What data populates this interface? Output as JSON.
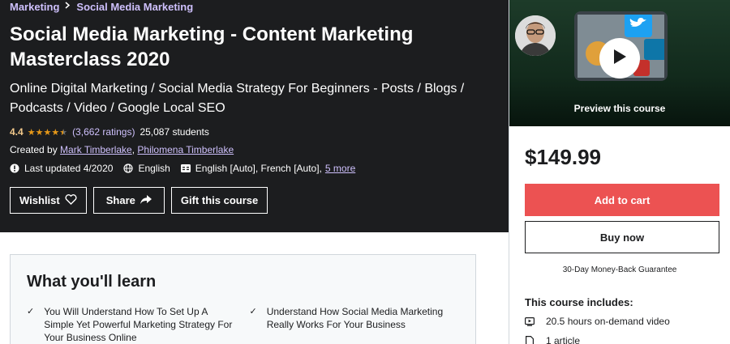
{
  "breadcrumb": {
    "items": [
      "Marketing",
      "Social Media Marketing"
    ],
    "separator": ">"
  },
  "course": {
    "title": "Social Media Marketing - Content Marketing Masterclass 2020",
    "subtitle": "Online Digital Marketing / Social Media Strategy For Beginners - Posts / Blogs / Podcasts / Video / Google Local SEO",
    "rating": "4.4",
    "rating_value": 4.4,
    "ratings_count": "(3,662 ratings)",
    "students": "25,087 students",
    "created_by_label": "Created by",
    "authors": [
      "Mark Timberlake",
      "Philomena Timberlake"
    ],
    "author_separator": ",",
    "last_updated": "Last updated 4/2020",
    "language": "English",
    "captions": "English [Auto], French [Auto],",
    "more_link": "5 more"
  },
  "actions": {
    "wishlist": "Wishlist",
    "share": "Share",
    "gift": "Gift this course"
  },
  "learn": {
    "title": "What you'll learn",
    "items": [
      "You Will Understand How To Set Up A Simple Yet Powerful Marketing Strategy For Your Business Online",
      "Understand How Social Media Marketing Really Works For Your Business"
    ]
  },
  "sidebar": {
    "preview_label": "Preview this course",
    "price": "$149.99",
    "add_to_cart": "Add to cart",
    "buy_now": "Buy now",
    "guarantee": "30-Day Money-Back Guarantee",
    "includes_title": "This course includes:",
    "includes": [
      "20.5 hours on-demand video",
      "1 article"
    ]
  },
  "colors": {
    "hero_bg": "#1c1d1f",
    "link": "#cec0fc",
    "star": "#e59819",
    "rating": "#f3ca8c",
    "cta": "#ec5252"
  },
  "icons": [
    "chevron-right-icon",
    "star-icon",
    "alert-icon",
    "globe-icon",
    "captions-icon",
    "heart-icon",
    "share-arrow-icon",
    "play-icon",
    "check-icon",
    "video-icon",
    "file-icon"
  ]
}
